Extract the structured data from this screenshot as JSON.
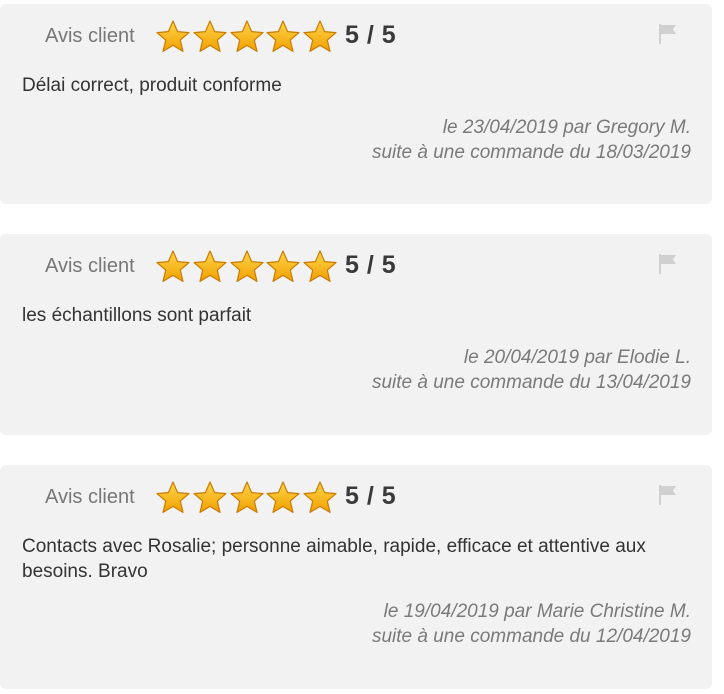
{
  "reviews": [
    {
      "label": "Avis client",
      "rating": 5,
      "score_text": "5 / 5",
      "text": "Délai correct, produit conforme",
      "date_line": "le 23/04/2019 par Gregory M.",
      "order_line": "suite à une commande du 18/03/2019"
    },
    {
      "label": "Avis client",
      "rating": 5,
      "score_text": "5 / 5",
      "text": "les échantillons sont parfait",
      "date_line": "le 20/04/2019 par Elodie L.",
      "order_line": "suite à une commande du 13/04/2019"
    },
    {
      "label": "Avis client",
      "rating": 5,
      "score_text": "5 / 5",
      "text": "Contacts avec Rosalie; personne aimable, rapide, efficace et attentive aux besoins. Bravo",
      "date_line": "le 19/04/2019 par Marie Christine M.",
      "order_line": "suite à une commande du 12/04/2019"
    }
  ],
  "icons": {
    "star": "star-icon",
    "flag": "flag-icon"
  },
  "colors": {
    "card_background": "#f2f2f2",
    "star_fill": "#f5a623",
    "star_outline": "#c97b00",
    "flag": "#d0d0d0"
  }
}
